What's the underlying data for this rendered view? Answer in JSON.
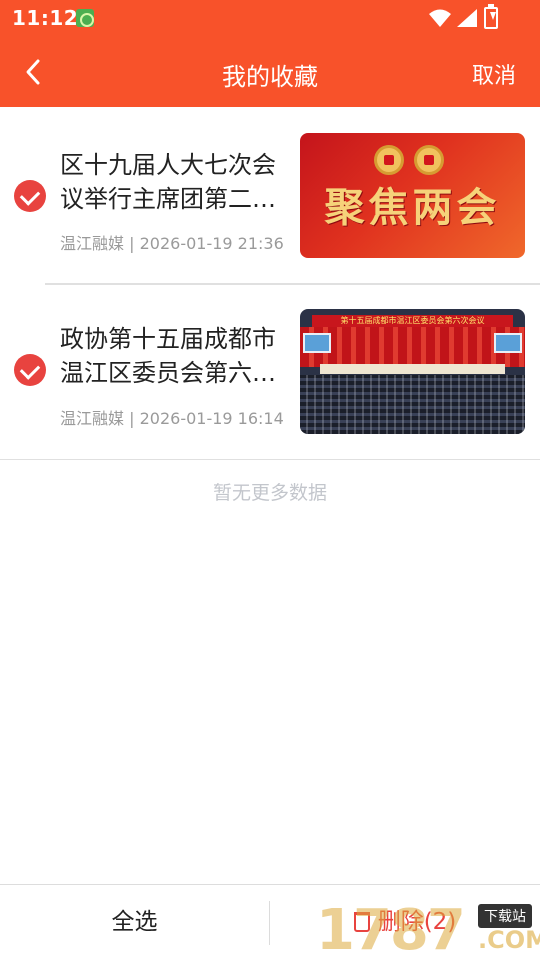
{
  "status_bar": {
    "time": "11:12"
  },
  "header": {
    "title": "我的收藏",
    "cancel_label": "取消"
  },
  "items": [
    {
      "title": "区十九届人大七次会议举行主席团第二次会议",
      "source": "温江融媒",
      "datetime": "2026-01-19 21:36",
      "image_text": "聚焦两会",
      "selected": true
    },
    {
      "title": "政协第十五届成都市温江区委员会第六次会议",
      "source": "温江融媒",
      "datetime": "2026-01-19 16:14",
      "image_text": "第十五届成都市温江区委员会第六次会议",
      "selected": true
    }
  ],
  "empty_hint": "暂无更多数据",
  "bottom": {
    "select_all_label": "全选",
    "delete_label": "删除(2)"
  },
  "watermark": {
    "number": "1787",
    "site": "下载站",
    "domain": ".COM"
  },
  "colors": {
    "accent": "#f8522a",
    "check": "#e8433f"
  }
}
